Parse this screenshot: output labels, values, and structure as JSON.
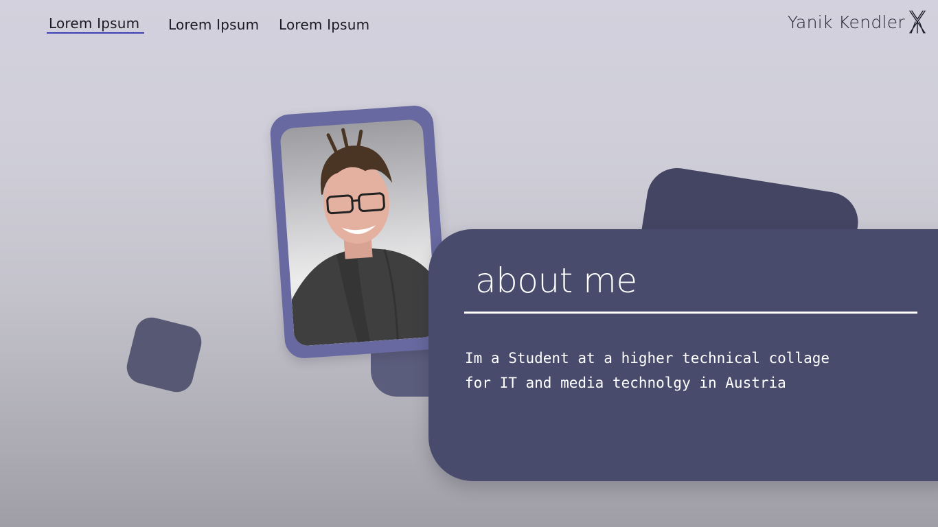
{
  "nav": {
    "items": [
      {
        "label": "Lorem Ipsum",
        "active": true
      },
      {
        "label": "Lorem Ipsum",
        "active": false
      },
      {
        "label": "Lorem Ipsum",
        "active": false
      }
    ]
  },
  "brand": {
    "name": "Yanik Kendler",
    "logo_icon": "yk-monogram-icon"
  },
  "about": {
    "title": "about me",
    "lines": [
      "Im a Student at a higher technical collage",
      "for IT and media technolgy in Austria"
    ]
  },
  "colors": {
    "accent_underline": "#3b41b5",
    "card": "#494b6c",
    "photo_frame": "#6769a0",
    "deco": "#575873"
  }
}
